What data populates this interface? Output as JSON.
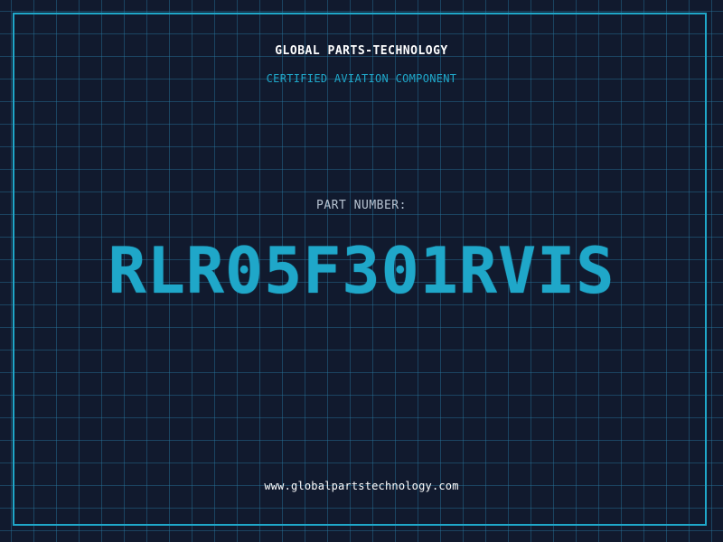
{
  "header": {
    "company_name": "GLOBAL PARTS-TECHNOLOGY",
    "subtitle": "CERTIFIED AVIATION COMPONENT"
  },
  "main": {
    "part_label": "PART NUMBER:",
    "part_number": "RLR05F301RVIS"
  },
  "footer": {
    "website": "www.globalpartstechnology.com"
  },
  "colors": {
    "background": "#111a2e",
    "accent": "#1fa7c9",
    "grid": "#28789f",
    "text_primary": "#ffffff",
    "text_muted": "#b8c4d2"
  }
}
